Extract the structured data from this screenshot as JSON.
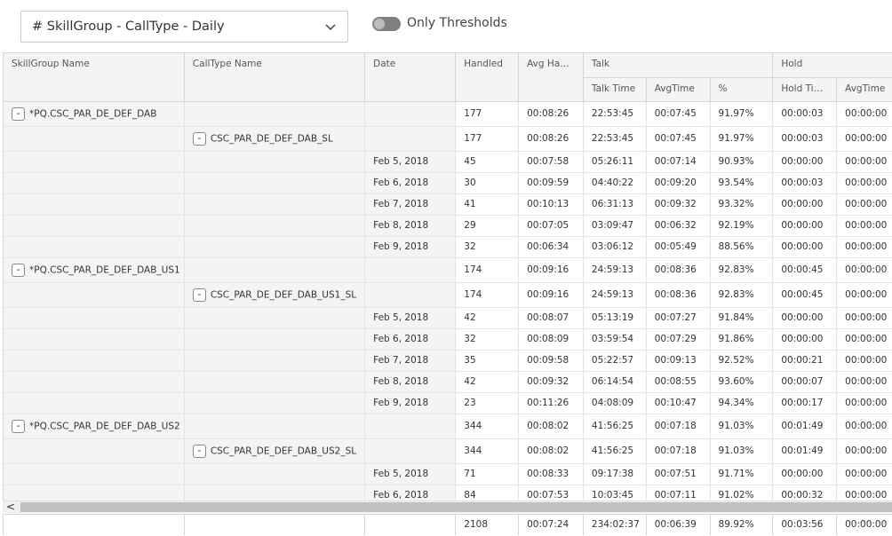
{
  "toolbar": {
    "report_selector": "# SkillGroup - CallType - Daily",
    "threshold_toggle_label": "Only Thresholds",
    "threshold_toggle_on": false
  },
  "headers": {
    "skillgroup": "SkillGroup Name",
    "calltype": "CallType Name",
    "date": "Date",
    "handled": "Handled",
    "avg_handle": "Avg Handl...",
    "talk_group": "Talk",
    "talk_time": "Talk Time",
    "talk_avg": "AvgTime",
    "talk_pct": "%",
    "hold_group": "Hold",
    "hold_time": "Hold Time",
    "hold_avg": "AvgTime"
  },
  "rows": [
    {
      "kind": "group",
      "skillgroup": "*PQ.CSC_PAR_DE_DEF_DAB",
      "calltype": "",
      "date": "",
      "handled": "177",
      "avg_handle": "00:08:26",
      "talk_time": "22:53:45",
      "talk_avg": "00:07:45",
      "talk_pct": "91.97%",
      "hold_time": "00:00:03",
      "hold_avg": "00:00:00"
    },
    {
      "kind": "sub",
      "skillgroup": "",
      "calltype": "CSC_PAR_DE_DEF_DAB_SL",
      "date": "",
      "handled": "177",
      "avg_handle": "00:08:26",
      "talk_time": "22:53:45",
      "talk_avg": "00:07:45",
      "talk_pct": "91.97%",
      "hold_time": "00:00:03",
      "hold_avg": "00:00:00"
    },
    {
      "kind": "leaf",
      "skillgroup": "",
      "calltype": "",
      "date": "Feb 5, 2018",
      "handled": "45",
      "avg_handle": "00:07:58",
      "talk_time": "05:26:11",
      "talk_avg": "00:07:14",
      "talk_pct": "90.93%",
      "hold_time": "00:00:00",
      "hold_avg": "00:00:00"
    },
    {
      "kind": "leaf",
      "skillgroup": "",
      "calltype": "",
      "date": "Feb 6, 2018",
      "handled": "30",
      "avg_handle": "00:09:59",
      "talk_time": "04:40:22",
      "talk_avg": "00:09:20",
      "talk_pct": "93.54%",
      "hold_time": "00:00:03",
      "hold_avg": "00:00:00"
    },
    {
      "kind": "leaf",
      "skillgroup": "",
      "calltype": "",
      "date": "Feb 7, 2018",
      "handled": "41",
      "avg_handle": "00:10:13",
      "talk_time": "06:31:13",
      "talk_avg": "00:09:32",
      "talk_pct": "93.32%",
      "hold_time": "00:00:00",
      "hold_avg": "00:00:00"
    },
    {
      "kind": "leaf",
      "skillgroup": "",
      "calltype": "",
      "date": "Feb 8, 2018",
      "handled": "29",
      "avg_handle": "00:07:05",
      "talk_time": "03:09:47",
      "talk_avg": "00:06:32",
      "talk_pct": "92.19%",
      "hold_time": "00:00:00",
      "hold_avg": "00:00:00"
    },
    {
      "kind": "leaf",
      "skillgroup": "",
      "calltype": "",
      "date": "Feb 9, 2018",
      "handled": "32",
      "avg_handle": "00:06:34",
      "talk_time": "03:06:12",
      "talk_avg": "00:05:49",
      "talk_pct": "88.56%",
      "hold_time": "00:00:00",
      "hold_avg": "00:00:00"
    },
    {
      "kind": "group",
      "skillgroup": "*PQ.CSC_PAR_DE_DEF_DAB_US1",
      "calltype": "",
      "date": "",
      "handled": "174",
      "avg_handle": "00:09:16",
      "talk_time": "24:59:13",
      "talk_avg": "00:08:36",
      "talk_pct": "92.83%",
      "hold_time": "00:00:45",
      "hold_avg": "00:00:00"
    },
    {
      "kind": "sub",
      "skillgroup": "",
      "calltype": "CSC_PAR_DE_DEF_DAB_US1_SL",
      "date": "",
      "handled": "174",
      "avg_handle": "00:09:16",
      "talk_time": "24:59:13",
      "talk_avg": "00:08:36",
      "talk_pct": "92.83%",
      "hold_time": "00:00:45",
      "hold_avg": "00:00:00"
    },
    {
      "kind": "leaf",
      "skillgroup": "",
      "calltype": "",
      "date": "Feb 5, 2018",
      "handled": "42",
      "avg_handle": "00:08:07",
      "talk_time": "05:13:19",
      "talk_avg": "00:07:27",
      "talk_pct": "91.84%",
      "hold_time": "00:00:00",
      "hold_avg": "00:00:00"
    },
    {
      "kind": "leaf",
      "skillgroup": "",
      "calltype": "",
      "date": "Feb 6, 2018",
      "handled": "32",
      "avg_handle": "00:08:09",
      "talk_time": "03:59:54",
      "talk_avg": "00:07:29",
      "talk_pct": "91.86%",
      "hold_time": "00:00:00",
      "hold_avg": "00:00:00"
    },
    {
      "kind": "leaf",
      "skillgroup": "",
      "calltype": "",
      "date": "Feb 7, 2018",
      "handled": "35",
      "avg_handle": "00:09:58",
      "talk_time": "05:22:57",
      "talk_avg": "00:09:13",
      "talk_pct": "92.52%",
      "hold_time": "00:00:21",
      "hold_avg": "00:00:00"
    },
    {
      "kind": "leaf",
      "skillgroup": "",
      "calltype": "",
      "date": "Feb 8, 2018",
      "handled": "42",
      "avg_handle": "00:09:32",
      "talk_time": "06:14:54",
      "talk_avg": "00:08:55",
      "talk_pct": "93.60%",
      "hold_time": "00:00:07",
      "hold_avg": "00:00:00"
    },
    {
      "kind": "leaf",
      "skillgroup": "",
      "calltype": "",
      "date": "Feb 9, 2018",
      "handled": "23",
      "avg_handle": "00:11:26",
      "talk_time": "04:08:09",
      "talk_avg": "00:10:47",
      "talk_pct": "94.34%",
      "hold_time": "00:00:17",
      "hold_avg": "00:00:00"
    },
    {
      "kind": "group",
      "skillgroup": "*PQ.CSC_PAR_DE_DEF_DAB_US2",
      "calltype": "",
      "date": "",
      "handled": "344",
      "avg_handle": "00:08:02",
      "talk_time": "41:56:25",
      "talk_avg": "00:07:18",
      "talk_pct": "91.03%",
      "hold_time": "00:01:49",
      "hold_avg": "00:00:00"
    },
    {
      "kind": "sub",
      "skillgroup": "",
      "calltype": "CSC_PAR_DE_DEF_DAB_US2_SL",
      "date": "",
      "handled": "344",
      "avg_handle": "00:08:02",
      "talk_time": "41:56:25",
      "talk_avg": "00:07:18",
      "talk_pct": "91.03%",
      "hold_time": "00:01:49",
      "hold_avg": "00:00:00"
    },
    {
      "kind": "leaf",
      "skillgroup": "",
      "calltype": "",
      "date": "Feb 5, 2018",
      "handled": "71",
      "avg_handle": "00:08:33",
      "talk_time": "09:17:38",
      "talk_avg": "00:07:51",
      "talk_pct": "91.71%",
      "hold_time": "00:00:00",
      "hold_avg": "00:00:00"
    },
    {
      "kind": "leaf",
      "skillgroup": "",
      "calltype": "",
      "date": "Feb 6, 2018",
      "handled": "84",
      "avg_handle": "00:07:53",
      "talk_time": "10:03:45",
      "talk_avg": "00:07:11",
      "talk_pct": "91.02%",
      "hold_time": "00:00:32",
      "hold_avg": "00:00:00"
    }
  ],
  "totals": {
    "handled": "2108",
    "avg_handle": "00:07:24",
    "talk_time": "234:02:37",
    "talk_avg": "00:06:39",
    "talk_pct": "89.92%",
    "hold_time": "00:03:56",
    "hold_avg": "00:00:00"
  },
  "collapse_glyph": "-",
  "scroll_left_glyph": "<"
}
